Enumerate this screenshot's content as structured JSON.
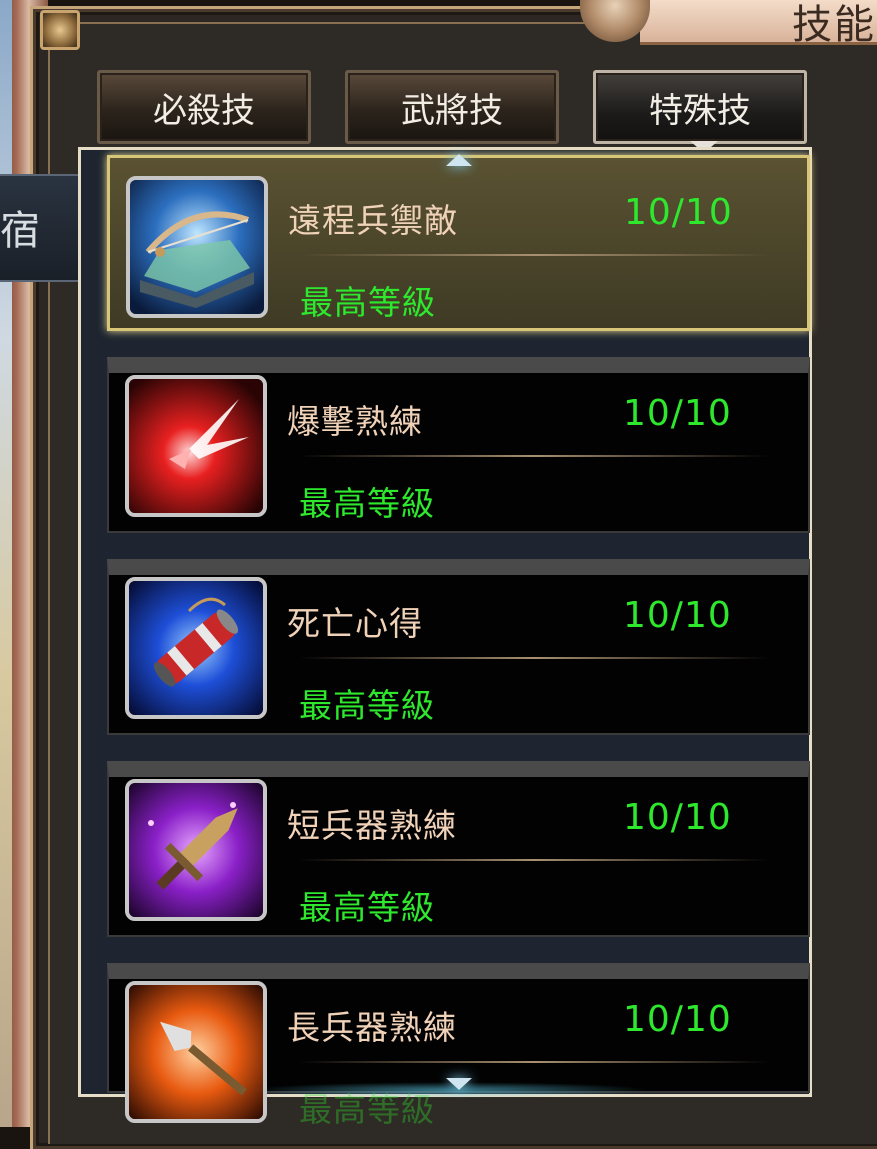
{
  "window": {
    "title": "技能"
  },
  "side_tab": {
    "label": "宿"
  },
  "tabs": [
    {
      "label": "必殺技",
      "active": false
    },
    {
      "label": "武將技",
      "active": false
    },
    {
      "label": "特殊技",
      "active": true
    }
  ],
  "skills": [
    {
      "name": "遠程兵禦敵",
      "level": "10/10",
      "status": "最高等級",
      "icon": "bow-book-icon",
      "selected": true
    },
    {
      "name": "爆擊熟練",
      "level": "10/10",
      "status": "最高等級",
      "icon": "critical-burst-icon",
      "selected": false
    },
    {
      "name": "死亡心得",
      "level": "10/10",
      "status": "最高等級",
      "icon": "scroll-icon",
      "selected": false
    },
    {
      "name": "短兵器熟練",
      "level": "10/10",
      "status": "最高等級",
      "icon": "dagger-icon",
      "selected": false
    },
    {
      "name": "長兵器熟練",
      "level": "10/10",
      "status": "最高等級",
      "icon": "spear-icon",
      "selected": false
    }
  ],
  "colors": {
    "level_text": "#2ee82e",
    "status_text": "#2ee82e",
    "name_text": "#f0d2b8",
    "selected_border": "#d8c678"
  }
}
